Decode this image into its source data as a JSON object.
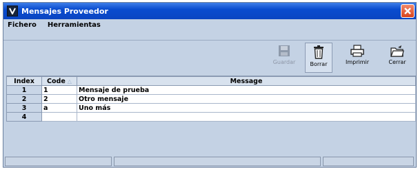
{
  "window": {
    "title": "Mensajes Proveedor"
  },
  "menu": {
    "items": [
      "Fichero",
      "Herramientas"
    ]
  },
  "toolbar": {
    "guardar": "Guardar",
    "borrar": "Borrar",
    "imprimir": "Imprimir",
    "cerrar": "Cerrar"
  },
  "table": {
    "columns": {
      "index": "Index",
      "code": "Code",
      "message": "Message"
    },
    "rows": [
      {
        "index": "1",
        "code": "1",
        "message": "Mensaje de prueba"
      },
      {
        "index": "2",
        "code": "2",
        "message": "Otro mensaje"
      },
      {
        "index": "3",
        "code": "a",
        "message": "Uno más"
      },
      {
        "index": "4",
        "code": "",
        "message": ""
      }
    ]
  },
  "colors": {
    "titlebar": "#0a4ccf",
    "background": "#c4d2e4",
    "close": "#d8431d"
  }
}
